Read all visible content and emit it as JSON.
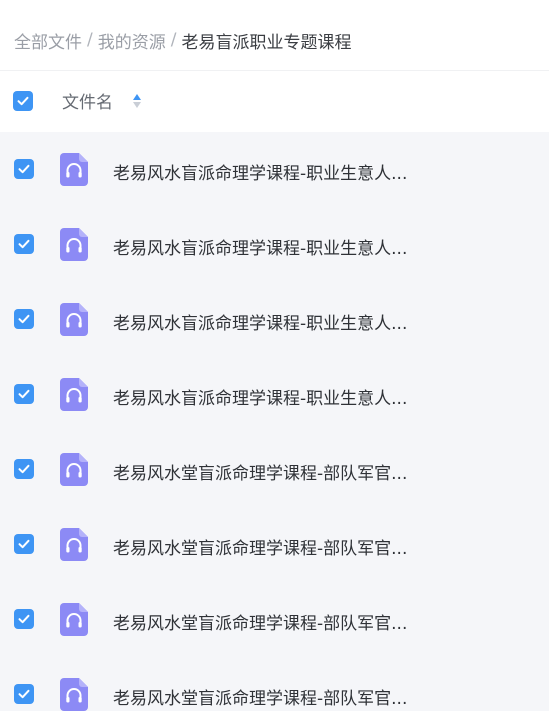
{
  "breadcrumb": {
    "items": [
      "全部文件",
      "我的资源"
    ],
    "separator": "/",
    "current": "老易盲派职业专题课程"
  },
  "header": {
    "select_all_checked": true,
    "column_label": "文件名",
    "sort_icon": "sort-icon"
  },
  "colors": {
    "accent": "#3e95f4",
    "file_icon": "#8c8af5",
    "list_background": "#f5f6f9"
  },
  "files": [
    {
      "name": "老易风水盲派命理学课程-职业生意人...",
      "icon": "audio-file-icon",
      "checked": true
    },
    {
      "name": "老易风水盲派命理学课程-职业生意人...",
      "icon": "audio-file-icon",
      "checked": true
    },
    {
      "name": "老易风水盲派命理学课程-职业生意人...",
      "icon": "audio-file-icon",
      "checked": true
    },
    {
      "name": "老易风水盲派命理学课程-职业生意人...",
      "icon": "audio-file-icon",
      "checked": true
    },
    {
      "name": "老易风水堂盲派命理学课程-部队军官...",
      "icon": "audio-file-icon",
      "checked": true
    },
    {
      "name": "老易风水堂盲派命理学课程-部队军官...",
      "icon": "audio-file-icon",
      "checked": true
    },
    {
      "name": "老易风水堂盲派命理学课程-部队军官...",
      "icon": "audio-file-icon",
      "checked": true
    },
    {
      "name": "老易风水堂盲派命理学课程-部队军官...",
      "icon": "audio-file-icon",
      "checked": true
    }
  ]
}
